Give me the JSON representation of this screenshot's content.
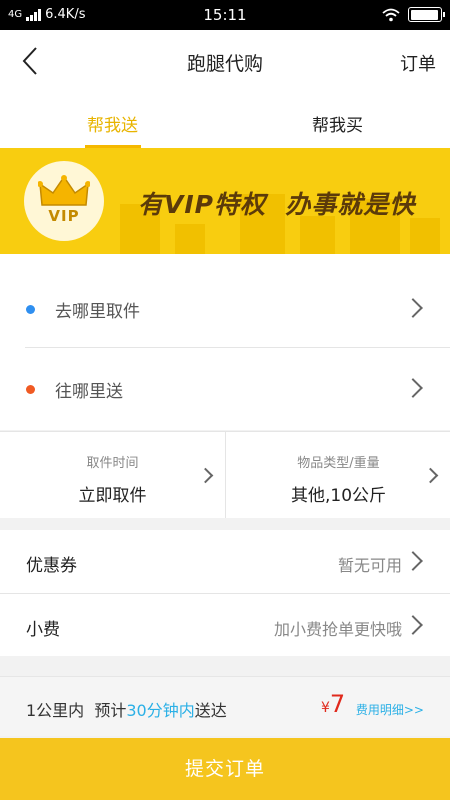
{
  "status_bar": {
    "network": "4G",
    "speed": "6.4K/s",
    "time": "15:11",
    "battery_level": 0.95
  },
  "header": {
    "title": "跑腿代购",
    "orders_label": "订单",
    "back_icon": "chevron-left-icon"
  },
  "tabs": [
    {
      "label": "帮我送",
      "active": true
    },
    {
      "label": "帮我买",
      "active": false
    }
  ],
  "vip_banner": {
    "badge_text": "VIP",
    "slogan": "有VIP特权  办事就是快",
    "badge_icon": "crown-icon"
  },
  "address": {
    "pickup_label": "去哪里取件",
    "pickup_dot_color": "#2f8ff0",
    "delivery_label": "往哪里送",
    "delivery_dot_color": "#f05a23"
  },
  "meta": {
    "pickup_time_caption": "取件时间",
    "pickup_time_value": "立即取件",
    "goods_caption": "物品类型/重量",
    "goods_value": "其他,10公斤"
  },
  "options": {
    "coupon_label": "优惠券",
    "coupon_value": "暂无可用",
    "tip_label": "小费",
    "tip_value": "加小费抢单更快哦"
  },
  "summary": {
    "distance": "1公里内",
    "eta_prefix": "预计",
    "eta_highlight": "30分钟内",
    "eta_suffix": "送达",
    "currency": "¥",
    "price": "7",
    "fee_detail_label": "费用明细>>"
  },
  "submit_label": "提交订单",
  "colors": {
    "accent": "#f5c51e",
    "price": "#e0291c",
    "link": "#2bb0e6"
  }
}
